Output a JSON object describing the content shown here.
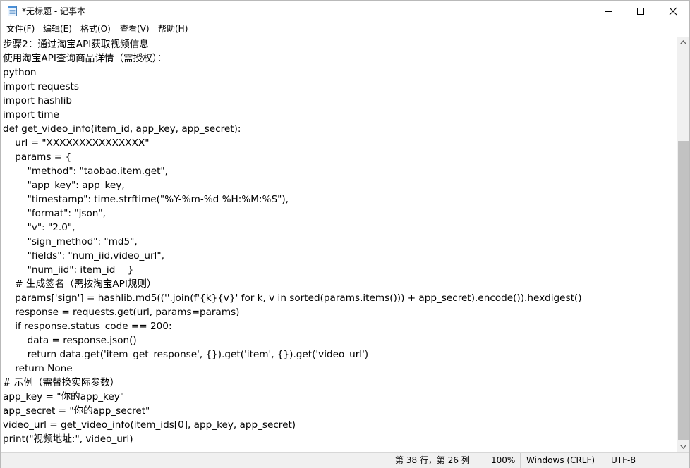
{
  "window": {
    "title": "*无标题 - 记事本",
    "icon": "notepad-icon",
    "controls": [
      "minimize-icon",
      "maximize-icon",
      "close-icon"
    ]
  },
  "menu": [
    "文件(F)",
    "编辑(E)",
    "格式(O)",
    "查看(V)",
    "帮助(H)"
  ],
  "editor": {
    "lines": [
      "步骤2：通过淘宝API获取视频信息",
      "使用淘宝API查询商品详情（需授权）：",
      "python",
      "import requests",
      "import hashlib",
      "import time",
      "def get_video_info(item_id, app_key, app_secret):",
      "    url = \"XXXXXXXXXXXXXXX\"",
      "    params = {",
      "        \"method\": \"taobao.item.get\",",
      "        \"app_key\": app_key,",
      "        \"timestamp\": time.strftime(\"%Y-%m-%d %H:%M:%S\"),",
      "        \"format\": \"json\",",
      "        \"v\": \"2.0\",",
      "        \"sign_method\": \"md5\",",
      "        \"fields\": \"num_iid,video_url\",",
      "        \"num_iid\": item_id    }",
      "    # 生成签名（需按淘宝API规则）",
      "    params['sign'] = hashlib.md5((''.join(f'{k}{v}' for k, v in sorted(params.items())) + app_secret).encode()).hexdigest()",
      "    response = requests.get(url, params=params)",
      "    if response.status_code == 200:",
      "        data = response.json()",
      "        return data.get('item_get_response', {}).get('item', {}).get('video_url')",
      "    return None",
      "# 示例（需替换实际参数）",
      "app_key = \"你的app_key\"",
      "app_secret = \"你的app_secret\"",
      "video_url = get_video_info(item_ids[0], app_key, app_secret)",
      "print(\"视频地址:\", video_url)"
    ]
  },
  "status": {
    "position": "第 38 行，第 26 列",
    "zoom": "100%",
    "line_ending": "Windows (CRLF)",
    "encoding": "UTF-8"
  }
}
